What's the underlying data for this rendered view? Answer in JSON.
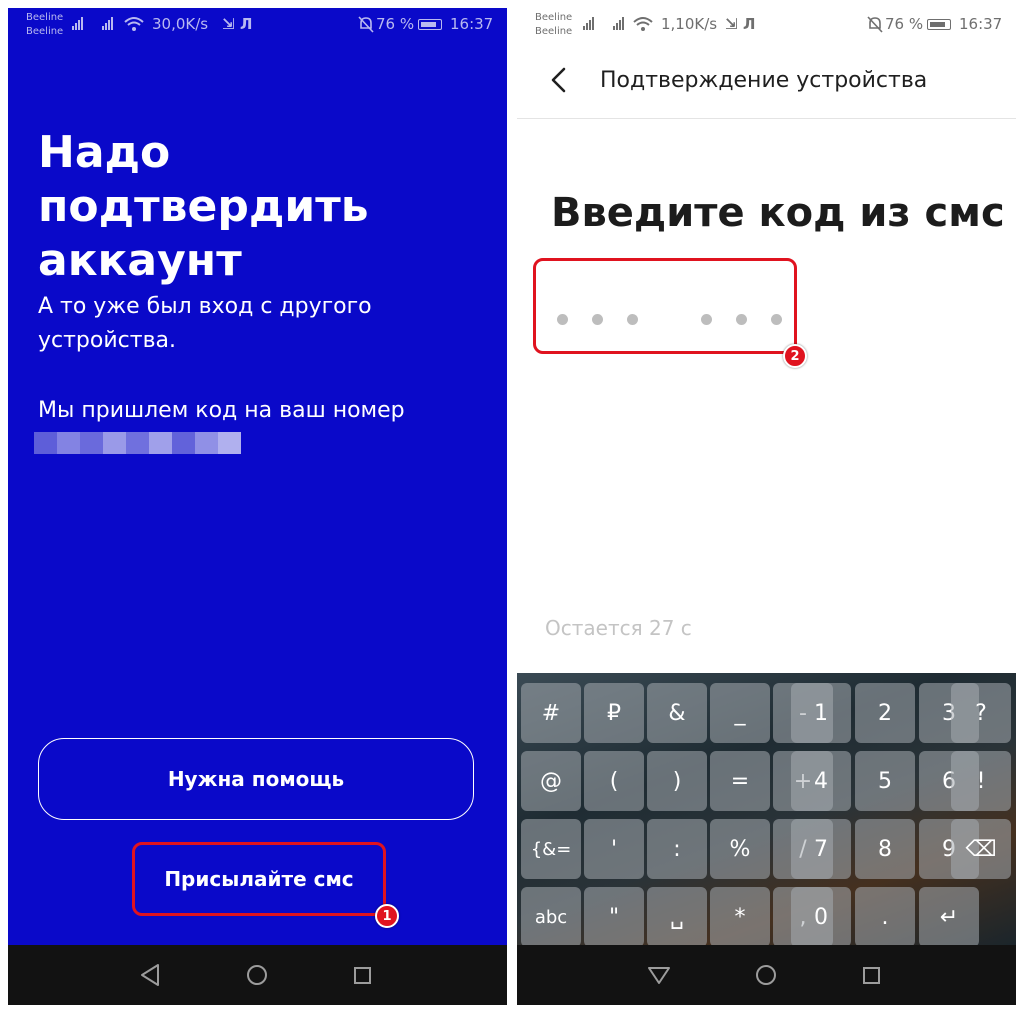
{
  "left": {
    "status": {
      "carrier1": "Beeline",
      "carrier2": "Beeline",
      "speed": "30,0K/s",
      "battery": "76 %",
      "time": "16:37"
    },
    "title": "Надо подтвердить аккаунт",
    "paragraph1": "А то уже был вход с другого устройства.",
    "paragraph2": "Мы пришлем код на ваш номер",
    "help_button": "Нужна помощь",
    "sms_button": "Присылайте смс",
    "badge": "1",
    "colors": {
      "background": "#0a09c9",
      "highlight": "#e0131f"
    }
  },
  "right": {
    "status": {
      "carrier1": "Beeline",
      "carrier2": "Beeline",
      "speed": "1,10K/s",
      "battery": "76 %",
      "time": "16:37"
    },
    "header_title": "Подтверждение устройства",
    "title": "Введите код из смс",
    "code_digits_entered": 0,
    "timer": "Остается 27 с",
    "badge": "2",
    "keyboard": {
      "keys": [
        {
          "label": "#",
          "name": "key-hash"
        },
        {
          "label": "₽",
          "name": "key-ruble"
        },
        {
          "label": "&",
          "name": "key-ampersand"
        },
        {
          "label": "_",
          "name": "key-underscore"
        },
        {
          "label": "-",
          "name": "key-minus"
        },
        {
          "label": "1",
          "name": "key-1"
        },
        {
          "label": "2",
          "name": "key-2"
        },
        {
          "label": "3",
          "name": "key-3"
        },
        {
          "label": "?",
          "name": "key-question"
        },
        {
          "label": "@",
          "name": "key-at"
        },
        {
          "label": "(",
          "name": "key-paren-open"
        },
        {
          "label": ")",
          "name": "key-paren-close"
        },
        {
          "label": "=",
          "name": "key-equals"
        },
        {
          "label": "+",
          "name": "key-plus"
        },
        {
          "label": "4",
          "name": "key-4"
        },
        {
          "label": "5",
          "name": "key-5"
        },
        {
          "label": "6",
          "name": "key-6"
        },
        {
          "label": "!",
          "name": "key-exclamation"
        },
        {
          "label": "{&=",
          "name": "key-symbols"
        },
        {
          "label": "'",
          "name": "key-apostrophe"
        },
        {
          "label": ":",
          "name": "key-colon"
        },
        {
          "label": "%",
          "name": "key-percent"
        },
        {
          "label": "/",
          "name": "key-slash"
        },
        {
          "label": "7",
          "name": "key-7"
        },
        {
          "label": "8",
          "name": "key-8"
        },
        {
          "label": "9",
          "name": "key-9"
        },
        {
          "label": "⌫",
          "name": "key-backspace"
        },
        {
          "label": "abc",
          "name": "key-abc"
        },
        {
          "label": "\"",
          "name": "key-quote"
        },
        {
          "label": "␣",
          "name": "key-space"
        },
        {
          "label": "*",
          "name": "key-asterisk"
        },
        {
          "label": ",",
          "name": "key-comma"
        },
        {
          "label": "0",
          "name": "key-0"
        },
        {
          "label": ".",
          "name": "key-period"
        },
        {
          "label": "↵",
          "name": "key-enter"
        }
      ]
    }
  },
  "icons": {
    "back": "chevron-left-icon",
    "nav_back": "triangle-back-icon",
    "nav_home": "circle-home-icon",
    "nav_recent": "square-recent-icon",
    "signal": "signal-bars-icon",
    "wifi": "wifi-icon",
    "battery": "battery-icon",
    "mute": "bell-off-icon"
  }
}
